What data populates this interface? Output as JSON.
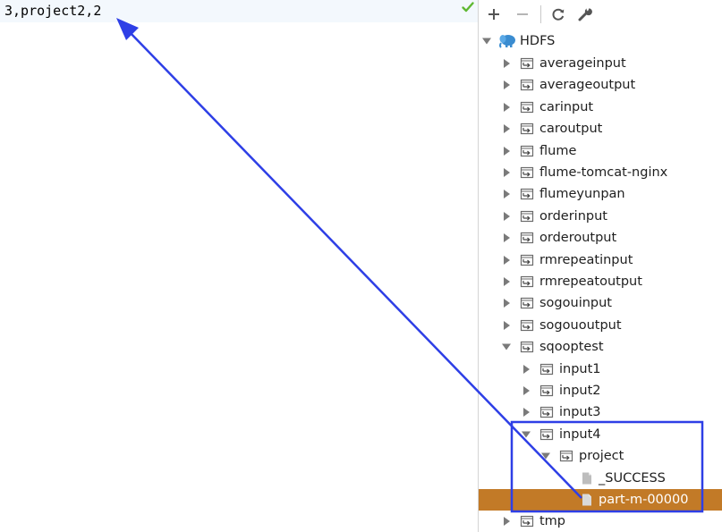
{
  "editor": {
    "line_text": "3,project2,2"
  },
  "toolbar": {
    "buttons": [
      {
        "icon": "plus-icon"
      },
      {
        "icon": "minus-icon"
      },
      {
        "icon": "refresh-icon"
      },
      {
        "icon": "wrench-icon"
      }
    ]
  },
  "tree": {
    "root": "HDFS",
    "items": [
      {
        "label": "averageinput"
      },
      {
        "label": "averageoutput"
      },
      {
        "label": "carinput"
      },
      {
        "label": "caroutput"
      },
      {
        "label": "flume"
      },
      {
        "label": "flume-tomcat-nginx"
      },
      {
        "label": "flumeyunpan"
      },
      {
        "label": "orderinput"
      },
      {
        "label": "orderoutput"
      },
      {
        "label": "rmrepeatinput"
      },
      {
        "label": "rmrepeatoutput"
      },
      {
        "label": "sogouinput"
      },
      {
        "label": "sogououtput"
      },
      {
        "label": "sqooptest"
      },
      {
        "label": "input1"
      },
      {
        "label": "input2"
      },
      {
        "label": "input3"
      },
      {
        "label": "input4"
      },
      {
        "label": "project"
      },
      {
        "label": "_SUCCESS"
      },
      {
        "label": "part-m-00000"
      },
      {
        "label": "tmp"
      }
    ]
  },
  "colors": {
    "selection": "#c27a27",
    "annotation": "#2e3fe6",
    "current_line": "#f3f8fd",
    "check": "#5fb832"
  }
}
